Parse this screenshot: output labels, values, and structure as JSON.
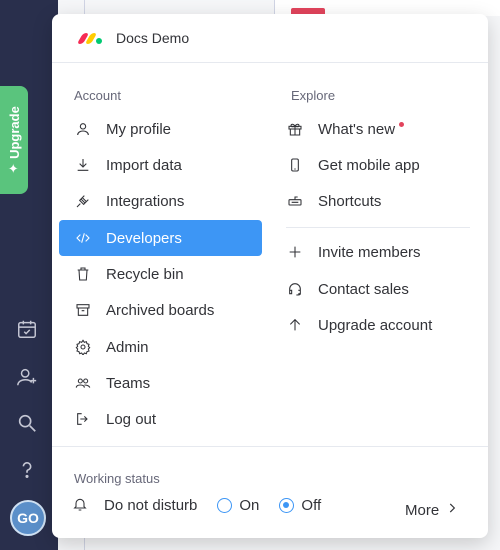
{
  "workspace": {
    "name": "Docs Demo"
  },
  "rail": {
    "upgrade_label": "Upgrade",
    "avatar_initials": "GO"
  },
  "account": {
    "label": "Account",
    "items": [
      {
        "label": "My profile",
        "icon": "user-icon"
      },
      {
        "label": "Import data",
        "icon": "download-icon"
      },
      {
        "label": "Integrations",
        "icon": "plug-icon"
      },
      {
        "label": "Developers",
        "icon": "code-icon",
        "active": true
      },
      {
        "label": "Recycle bin",
        "icon": "trash-icon"
      },
      {
        "label": "Archived boards",
        "icon": "archive-icon"
      },
      {
        "label": "Admin",
        "icon": "gear-icon"
      },
      {
        "label": "Teams",
        "icon": "team-icon"
      },
      {
        "label": "Log out",
        "icon": "logout-icon"
      }
    ]
  },
  "explore": {
    "label": "Explore",
    "items": [
      {
        "label": "What's new",
        "icon": "gift-icon",
        "notification": true
      },
      {
        "label": "Get mobile app",
        "icon": "mobile-icon"
      },
      {
        "label": "Shortcuts",
        "icon": "keyboard-icon"
      },
      {
        "label": "Invite members",
        "icon": "plus-icon"
      },
      {
        "label": "Contact sales",
        "icon": "headset-icon"
      },
      {
        "label": "Upgrade account",
        "icon": "arrow-up-icon"
      }
    ]
  },
  "working_status": {
    "label": "Working status",
    "dnd_label": "Do not disturb",
    "options": [
      {
        "label": "On",
        "checked": false
      },
      {
        "label": "Off",
        "checked": true
      }
    ],
    "more_label": "More"
  },
  "colors": {
    "rail": "#292f4c",
    "upgrade": "#5ac47d",
    "active": "#3d96f5",
    "notification": "#e2445c"
  }
}
